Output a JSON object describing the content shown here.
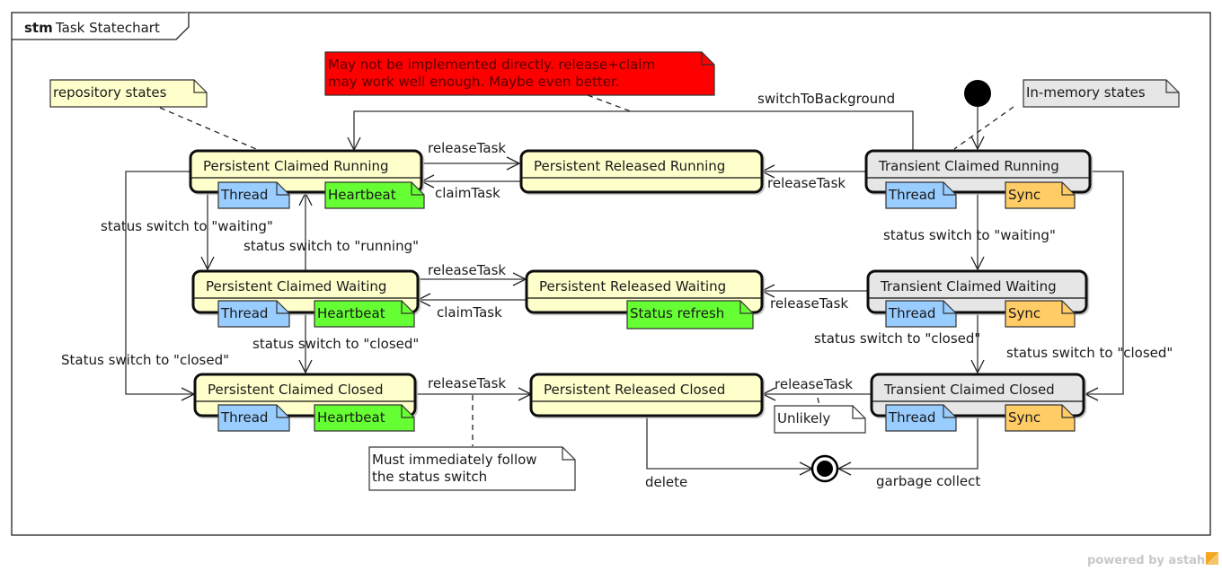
{
  "frame": {
    "keyword": "stm",
    "title": "Task Statechart"
  },
  "colors": {
    "persistent_state": "#ffffcc",
    "transient_state": "#e6e6e6",
    "thread_note": "#99ccff",
    "heartbeat_note": "#66ff33",
    "sync_note": "#ffcc66",
    "warning_note": "#ff0000",
    "plain_note": "#ffffff",
    "repo_note": "#ffffcc",
    "memory_note": "#e6e6e6"
  },
  "states": {
    "pcr": {
      "name": "Persistent Claimed Running"
    },
    "prr": {
      "name": "Persistent Released Running"
    },
    "tcr": {
      "name": "Transient Claimed Running"
    },
    "pcw": {
      "name": "Persistent Claimed Waiting"
    },
    "prw": {
      "name": "Persistent Released Waiting"
    },
    "tcw": {
      "name": "Transient Claimed Waiting"
    },
    "pcc": {
      "name": "Persistent Claimed Closed"
    },
    "prc": {
      "name": "Persistent Released Closed"
    },
    "tcc": {
      "name": "Transient Claimed Closed"
    }
  },
  "tags": {
    "thread": "Thread",
    "heartbeat": "Heartbeat",
    "sync": "Sync",
    "status_refresh": "Status refresh"
  },
  "notes": {
    "repository": "repository states",
    "in_memory": "In-memory states",
    "warning_line1": "May not be implemented directly. release+claim",
    "warning_line2": "may work well enough. Maybe even better.",
    "must_follow_line1": "Must immediately follow",
    "must_follow_line2": "the status switch",
    "unlikely": "Unlikely"
  },
  "transitions": {
    "switch_to_background": "switchToBackground",
    "release_task": "releaseTask",
    "claim_task": "claimTask",
    "to_waiting": "status switch to \"waiting\"",
    "to_running": "status switch to \"running\"",
    "to_closed": "status switch to \"closed\"",
    "to_closed_cap": "Status switch to \"closed\"",
    "delete": "delete",
    "garbage_collect": "garbage collect"
  },
  "watermark": "powered by astah*"
}
